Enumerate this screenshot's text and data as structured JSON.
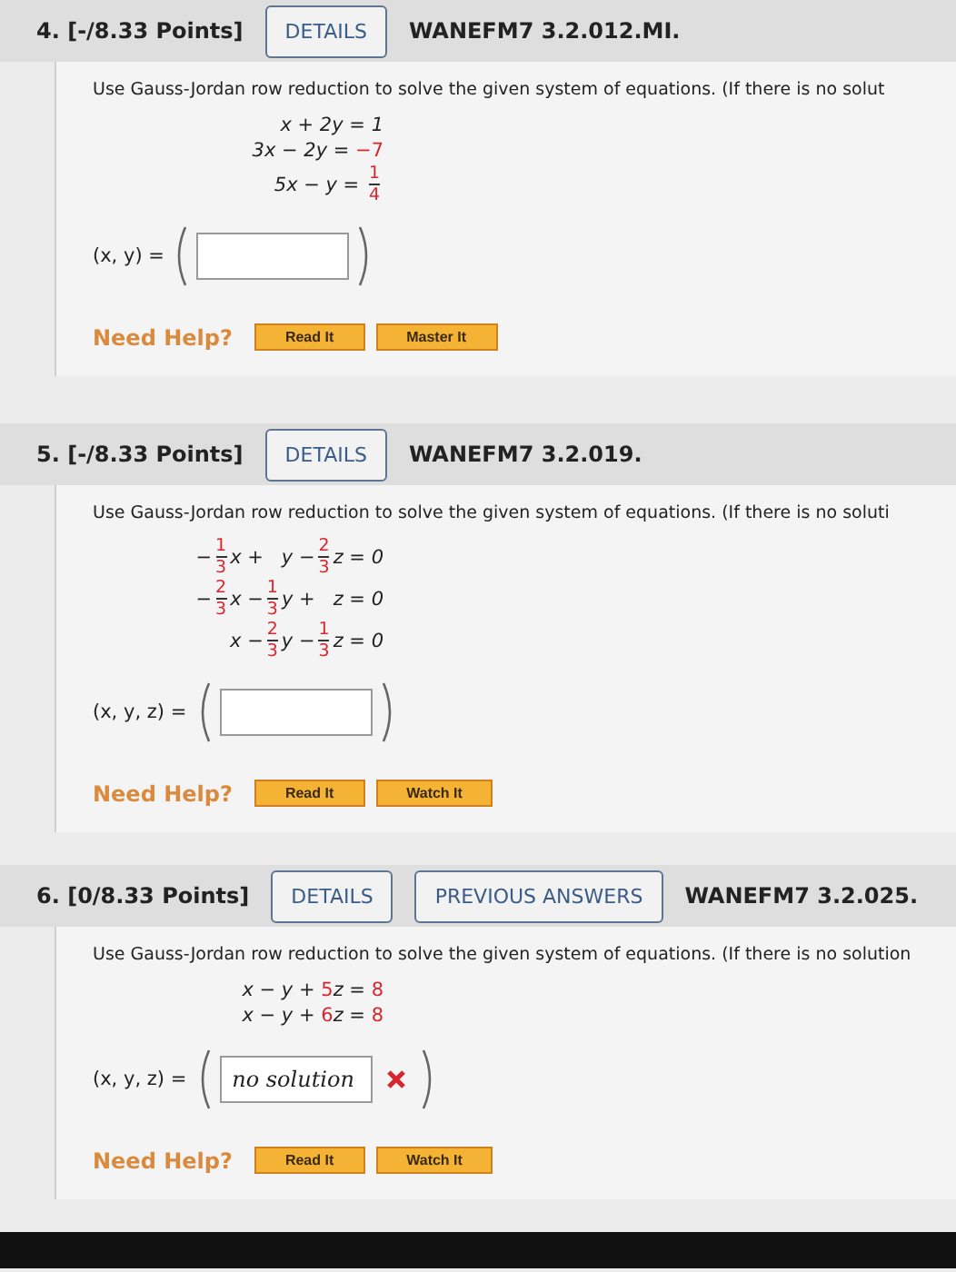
{
  "problems": [
    {
      "number": "4.",
      "points": "[-/8.33 Points]",
      "buttons": [
        {
          "label": "DETAILS"
        }
      ],
      "code": "WANEFM7 3.2.012.MI.",
      "prompt": "Use Gauss-Jordan row reduction to solve the given system of equations. (If there is no solut",
      "equations": [
        [
          {
            "kind": "text",
            "text": "x + 2y = "
          },
          {
            "kind": "text",
            "text": "1"
          }
        ],
        [
          {
            "kind": "text",
            "text": "3x − 2y = "
          },
          {
            "kind": "red",
            "text": "−7"
          }
        ],
        [
          {
            "kind": "text",
            "text": "5x − y = "
          },
          {
            "kind": "frac",
            "num": "1",
            "den": "4"
          }
        ]
      ],
      "answer": {
        "label": "(x, y) ="
      },
      "help": {
        "label": "Need Help?",
        "buttons": [
          "Read It",
          "Master It"
        ]
      }
    },
    {
      "number": "5.",
      "points": "[-/8.33 Points]",
      "buttons": [
        {
          "label": "DETAILS"
        }
      ],
      "code": "WANEFM7 3.2.019.",
      "prompt": "Use Gauss-Jordan row reduction to solve the given system of equations. (If there is no soluti",
      "equations": [
        [
          {
            "kind": "text",
            "text": "−"
          },
          {
            "kind": "frac",
            "num": "1",
            "den": "3"
          },
          {
            "kind": "text",
            "text": "x +   y −"
          },
          {
            "kind": "frac",
            "num": "2",
            "den": "3"
          },
          {
            "kind": "text",
            "text": "z = 0"
          }
        ],
        [
          {
            "kind": "text",
            "text": "−"
          },
          {
            "kind": "frac",
            "num": "2",
            "den": "3"
          },
          {
            "kind": "text",
            "text": "x −"
          },
          {
            "kind": "frac",
            "num": "1",
            "den": "3"
          },
          {
            "kind": "text",
            "text": "y +   z = 0"
          }
        ],
        [
          {
            "kind": "text",
            "text": "x −"
          },
          {
            "kind": "frac",
            "num": "2",
            "den": "3"
          },
          {
            "kind": "text",
            "text": "y −"
          },
          {
            "kind": "frac",
            "num": "1",
            "den": "3"
          },
          {
            "kind": "text",
            "text": "z = 0"
          }
        ]
      ],
      "answer": {
        "label": "(x, y, z) ="
      },
      "help": {
        "label": "Need Help?",
        "buttons": [
          "Read It",
          "Watch It"
        ]
      }
    },
    {
      "number": "6.",
      "points": "[0/8.33 Points]",
      "buttons": [
        {
          "label": "DETAILS"
        },
        {
          "label": "PREVIOUS ANSWERS"
        }
      ],
      "code": "WANEFM7 3.2.025.",
      "prompt": "Use Gauss-Jordan row reduction to solve the given system of equations. (If there is no solution",
      "equations": [
        [
          {
            "kind": "text",
            "text": "x − y + "
          },
          {
            "kind": "red",
            "text": "5"
          },
          {
            "kind": "text",
            "text": "z = "
          },
          {
            "kind": "red",
            "text": "8"
          }
        ],
        [
          {
            "kind": "text",
            "text": "x − y + "
          },
          {
            "kind": "red",
            "text": "6"
          },
          {
            "kind": "text",
            "text": "z = "
          },
          {
            "kind": "red",
            "text": "8"
          }
        ]
      ],
      "answer": {
        "label": "(x, y, z) =",
        "value": "no solution",
        "wrong": true
      },
      "help": {
        "label": "Need Help?",
        "buttons": [
          "Read It",
          "Watch It"
        ]
      }
    }
  ]
}
